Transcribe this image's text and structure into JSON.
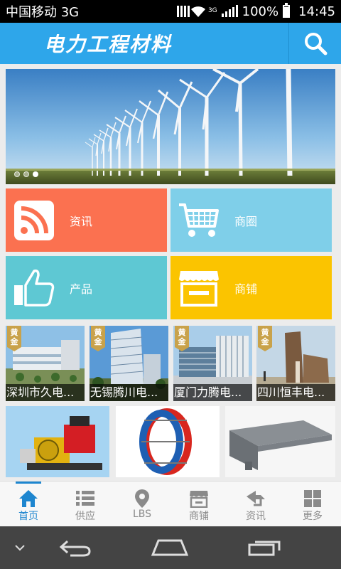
{
  "status_bar": {
    "carrier": "中国移动 3G",
    "network_badge": "3G",
    "battery": "100%",
    "time": "14:45"
  },
  "header": {
    "title": "电力工程材料",
    "search_icon": "search-icon"
  },
  "banner": {
    "page_count": 3,
    "current_page": 3
  },
  "tiles": [
    {
      "label": "资讯",
      "icon": "rss-icon",
      "color": "#fb7150"
    },
    {
      "label": "商圈",
      "icon": "cart-icon",
      "color": "#7fcfe9"
    },
    {
      "label": "产品",
      "icon": "thumbs-up-icon",
      "color": "#5ec8d3"
    },
    {
      "label": "商铺",
      "icon": "shop-icon",
      "color": "#fbc400"
    }
  ],
  "suppliers": {
    "badge": [
      "黄",
      "金"
    ],
    "items": [
      {
        "name": "深圳市久电..."
      },
      {
        "name": "无锡腾川电..."
      },
      {
        "name": "厦门力腾电..."
      },
      {
        "name": "四川恒丰电..."
      }
    ]
  },
  "bottom_nav": {
    "active_index": 0,
    "items": [
      {
        "label": "首页",
        "icon": "home-icon"
      },
      {
        "label": "供应",
        "icon": "list-icon"
      },
      {
        "label": "LBS",
        "icon": "location-pin-icon"
      },
      {
        "label": "商铺",
        "icon": "store-icon"
      },
      {
        "label": "资讯",
        "icon": "news-icon"
      },
      {
        "label": "更多",
        "icon": "grid-icon"
      }
    ]
  },
  "colors": {
    "header": "#2ea6ea",
    "nav_active": "#1e86cf",
    "badge_gold": "#c9a24a"
  }
}
